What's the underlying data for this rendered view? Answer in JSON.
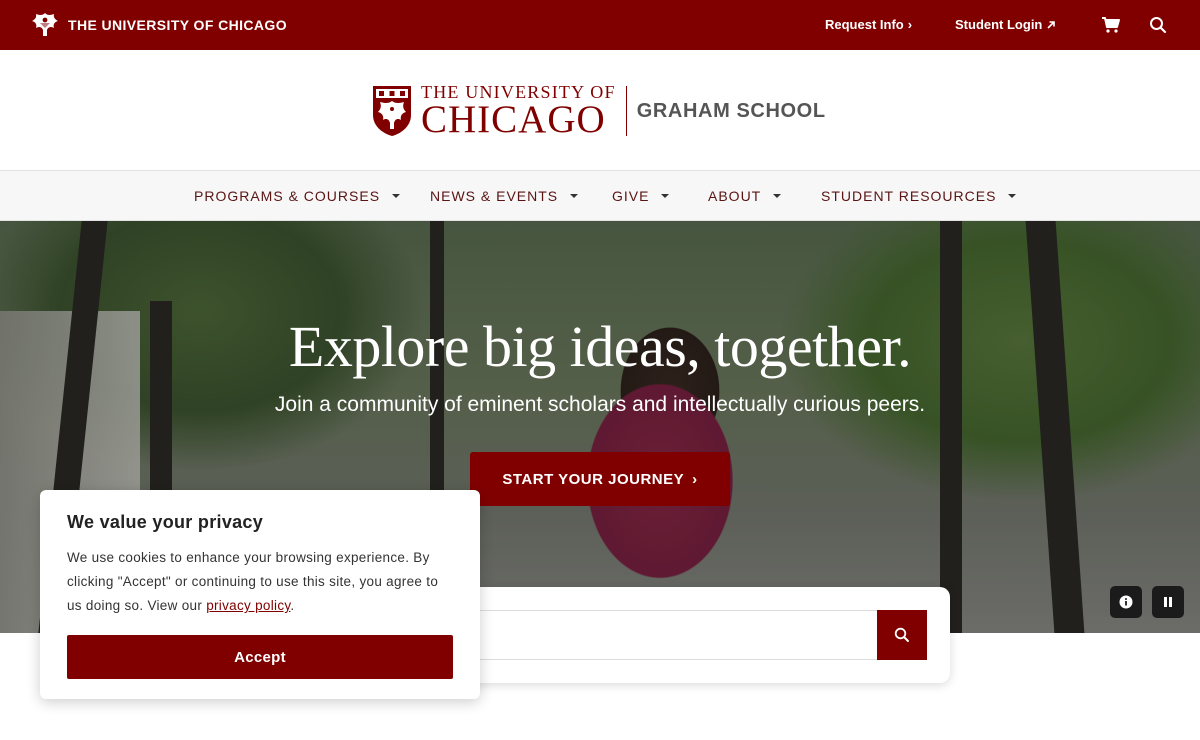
{
  "topbar": {
    "brand": "THE UNIVERSITY OF CHICAGO",
    "request_info": "Request Info",
    "student_login": "Student Login",
    "cart_icon": "cart-icon",
    "search_icon": "search-icon"
  },
  "logo": {
    "line1": "THE UNIVERSITY OF",
    "line2": "CHICAGO",
    "school": "GRAHAM SCHOOL"
  },
  "nav": {
    "items": [
      {
        "label": "PROGRAMS & COURSES"
      },
      {
        "label": "NEWS & EVENTS"
      },
      {
        "label": "GIVE"
      },
      {
        "label": "ABOUT"
      },
      {
        "label": "STUDENT RESOURCES"
      }
    ]
  },
  "hero": {
    "headline": "Explore big ideas, together.",
    "subheadline": "Join a community of eminent scholars and intellectually curious peers.",
    "cta": "START YOUR JOURNEY",
    "info_icon": "info-icon",
    "pause_icon": "pause-icon"
  },
  "search": {
    "value": "",
    "placeholder": ""
  },
  "cookie": {
    "title": "We value your privacy",
    "text": "We use cookies to enhance your browsing experience. By clicking \"Accept\" or continuing to use this site, you agree to us doing so. View our ",
    "link": "privacy policy",
    "text_end": ".",
    "accept": "Accept"
  },
  "colors": {
    "maroon": "#800000",
    "nav_text": "#5a1414",
    "school_gray": "#555555"
  }
}
